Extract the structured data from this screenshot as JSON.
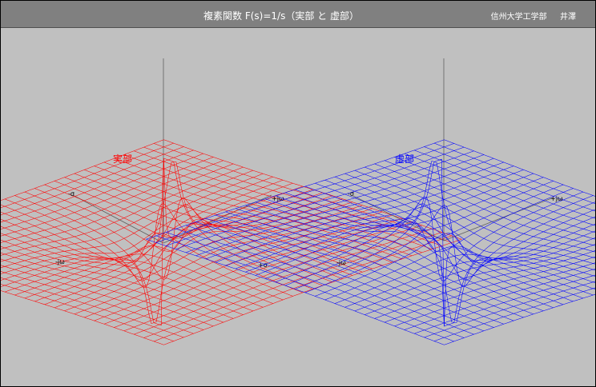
{
  "header": {
    "title": "複素関数 F(s)=1/s（実部 と 虚部）",
    "author": "信州大学工学部 　 井澤"
  },
  "panels": [
    {
      "name": "real",
      "label": "実部",
      "color": "#ff0000",
      "axis_labels": {
        "neg_sigma": "-σ",
        "pos_sigma": "+σ",
        "pos_jw": "+jω",
        "neg_jw": "-jω"
      }
    },
    {
      "name": "imag",
      "label": "虚部",
      "color": "#0000ff",
      "axis_labels": {
        "neg_sigma": "-σ",
        "pos_jw": "+jω",
        "neg_jw": "-jω"
      }
    }
  ],
  "colors": {
    "background": "#c0c0c0",
    "titlebar": "#808080"
  }
}
